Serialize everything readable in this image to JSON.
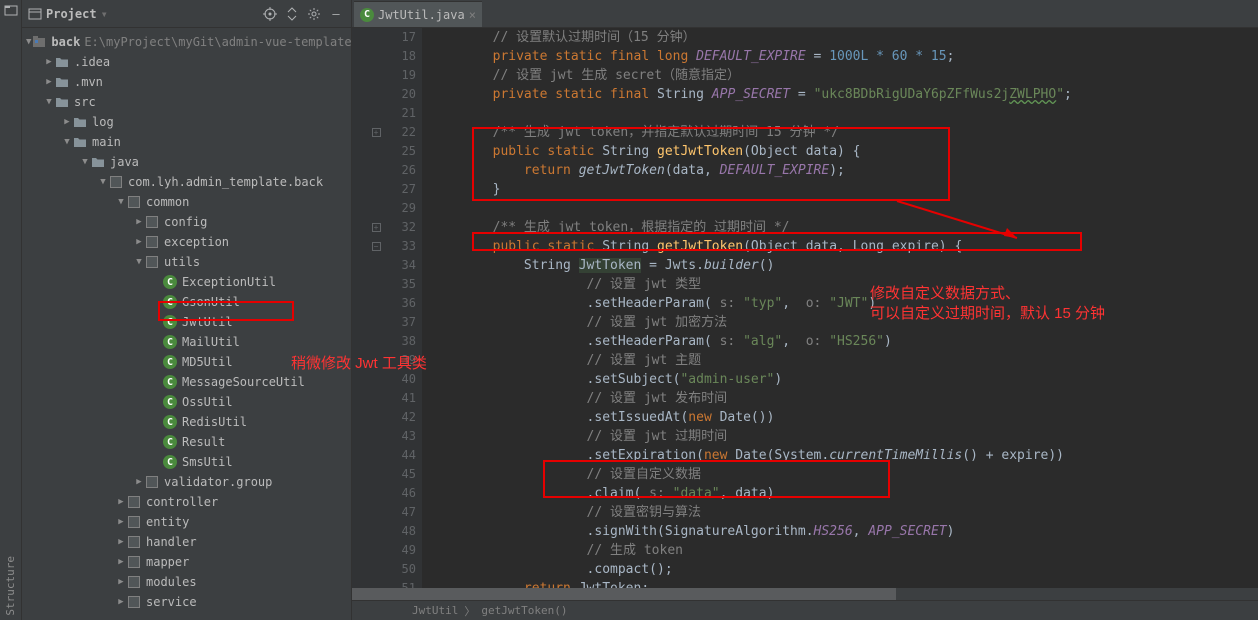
{
  "sidebar": {
    "title": "Project",
    "project_name": "back",
    "project_path": "E:\\myProject\\myGit\\admin-vue-template\\bac",
    "tree": [
      {
        "ind": 1,
        "arrow": "right",
        "icon": "folder",
        "label": ".idea",
        "cls": "tree-label"
      },
      {
        "ind": 1,
        "arrow": "right",
        "icon": "folder",
        "label": ".mvn",
        "cls": "tree-label"
      },
      {
        "ind": 1,
        "arrow": "down",
        "icon": "folder",
        "label": "src",
        "cls": "tree-label"
      },
      {
        "ind": 2,
        "arrow": "right",
        "icon": "folder",
        "label": "log",
        "cls": "tree-label"
      },
      {
        "ind": 2,
        "arrow": "down",
        "icon": "folder",
        "label": "main",
        "cls": "tree-label"
      },
      {
        "ind": 3,
        "arrow": "down",
        "icon": "folder",
        "label": "java",
        "cls": "tree-label"
      },
      {
        "ind": 4,
        "arrow": "down",
        "icon": "package",
        "label": "com.lyh.admin_template.back",
        "cls": "tree-label"
      },
      {
        "ind": 5,
        "arrow": "down",
        "icon": "package",
        "label": "common",
        "cls": "tree-label"
      },
      {
        "ind": 6,
        "arrow": "right",
        "icon": "package",
        "label": "config",
        "cls": "tree-label"
      },
      {
        "ind": 6,
        "arrow": "right",
        "icon": "package",
        "label": "exception",
        "cls": "tree-label"
      },
      {
        "ind": 6,
        "arrow": "down",
        "icon": "package",
        "label": "utils",
        "cls": "tree-label"
      },
      {
        "ind": 7,
        "arrow": "",
        "icon": "class",
        "label": "ExceptionUtil",
        "cls": "tree-label"
      },
      {
        "ind": 7,
        "arrow": "",
        "icon": "class",
        "label": "GsonUtil",
        "cls": "tree-label"
      },
      {
        "ind": 7,
        "arrow": "",
        "icon": "class",
        "label": "JwtUtil",
        "cls": "tree-label"
      },
      {
        "ind": 7,
        "arrow": "",
        "icon": "class",
        "label": "MailUtil",
        "cls": "tree-label"
      },
      {
        "ind": 7,
        "arrow": "",
        "icon": "class",
        "label": "MD5Util",
        "cls": "tree-label"
      },
      {
        "ind": 7,
        "arrow": "",
        "icon": "class",
        "label": "MessageSourceUtil",
        "cls": "tree-label"
      },
      {
        "ind": 7,
        "arrow": "",
        "icon": "class",
        "label": "OssUtil",
        "cls": "tree-label"
      },
      {
        "ind": 7,
        "arrow": "",
        "icon": "class",
        "label": "RedisUtil",
        "cls": "tree-label"
      },
      {
        "ind": 7,
        "arrow": "",
        "icon": "class",
        "label": "Result",
        "cls": "tree-label"
      },
      {
        "ind": 7,
        "arrow": "",
        "icon": "class",
        "label": "SmsUtil",
        "cls": "tree-label"
      },
      {
        "ind": 6,
        "arrow": "right",
        "icon": "package",
        "label": "validator.group",
        "cls": "tree-label"
      },
      {
        "ind": 5,
        "arrow": "right",
        "icon": "package",
        "label": "controller",
        "cls": "tree-label"
      },
      {
        "ind": 5,
        "arrow": "right",
        "icon": "package",
        "label": "entity",
        "cls": "tree-label"
      },
      {
        "ind": 5,
        "arrow": "right",
        "icon": "package",
        "label": "handler",
        "cls": "tree-label"
      },
      {
        "ind": 5,
        "arrow": "right",
        "icon": "package",
        "label": "mapper",
        "cls": "tree-label"
      },
      {
        "ind": 5,
        "arrow": "right",
        "icon": "package",
        "label": "modules",
        "cls": "tree-label"
      },
      {
        "ind": 5,
        "arrow": "right",
        "icon": "package",
        "label": "service",
        "cls": "tree-label"
      }
    ]
  },
  "tab": {
    "label": "JwtUtil.java"
  },
  "line_numbers": [
    "17",
    "18",
    "19",
    "20",
    "21",
    "22",
    "25",
    "26",
    "27",
    "",
    "29",
    "32",
    "33",
    "34",
    "35",
    "36",
    "37",
    "38",
    "39",
    "40",
    "41",
    "42",
    "43",
    "44",
    "45",
    "46",
    "47",
    "48",
    "49",
    "50",
    "51"
  ],
  "gutter_marks": {
    "22": "fold-plus",
    "29": "fold-plus",
    "32": "fold-minus",
    "51": "fold-minus"
  },
  "breadcrumb": {
    "class": "JwtUtil",
    "method": "getJwtToken()"
  },
  "annotations": {
    "left_note": "稍微修改 Jwt 工具类",
    "right_note_1": "修改自定义数据方式、",
    "right_note_2": "可以自定义过期时间，默认 15 分钟"
  },
  "code": {
    "c17": "// 设置默认过期时间（15 分钟）",
    "c18_expr": "1000L * 60 * 15",
    "c19": "// 设置 jwt 生成 secret（随意指定）",
    "c20_str": "\"ukc8BDbRigUDaY6pZFfWus2j",
    "c20_spell": "ZWLPHO",
    "c22": "/** 生成 jwt token，并指定默认过期时间 15 分钟 */",
    "c29": "/** 生成 jwt token，根据指定的 过期时间 */",
    "c34": "// 设置 jwt 类型",
    "c36": "// 设置 jwt 加密方法",
    "c38": "// 设置 jwt 主题",
    "c40": "// 设置 jwt 发布时间",
    "c42": "// 设置 jwt 过期时间",
    "c44": "// 设置自定义数据",
    "c46": "// 设置密钥与算法",
    "c48": "// 生成 token"
  }
}
